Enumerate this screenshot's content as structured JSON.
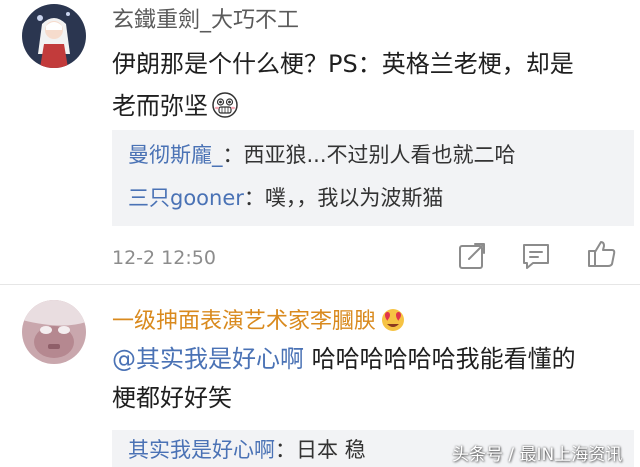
{
  "comments": [
    {
      "username": "玄鐵重劍_大巧不工",
      "line1": "伊朗那是个什么梗？PS：英格兰老梗，却是",
      "line2": "老而弥坚",
      "line2_emoji": "grimace-emoji",
      "replies": [
        {
          "name": "曼彻斯龐_",
          "text": "：西亚狼...不过别人看也就二哈"
        },
        {
          "name": "三只gooner",
          "text": "：噗，，我以为波斯猫"
        }
      ],
      "timestamp": "12-2 12:50",
      "actions": [
        "share-icon",
        "comment-icon",
        "like-icon"
      ]
    },
    {
      "username": "一级抻面表演艺术家李膕腴",
      "username_emoji": "heart-eyes-emoji",
      "mention": "@其实我是好心啊",
      "line1_rest": " 哈哈哈哈哈哈我能看懂的",
      "line2": "梗都好好笑",
      "replies": [
        {
          "name": "其实我是好心啊",
          "text": "：日本 稳"
        }
      ]
    }
  ],
  "watermark": "头条号 / 最IN上海资讯",
  "colors": {
    "reply_name": "#4a72b5",
    "username_gold": "#d98a1e",
    "reply_bg": "#f2f3f5",
    "timestamp": "#8c8c8c"
  }
}
